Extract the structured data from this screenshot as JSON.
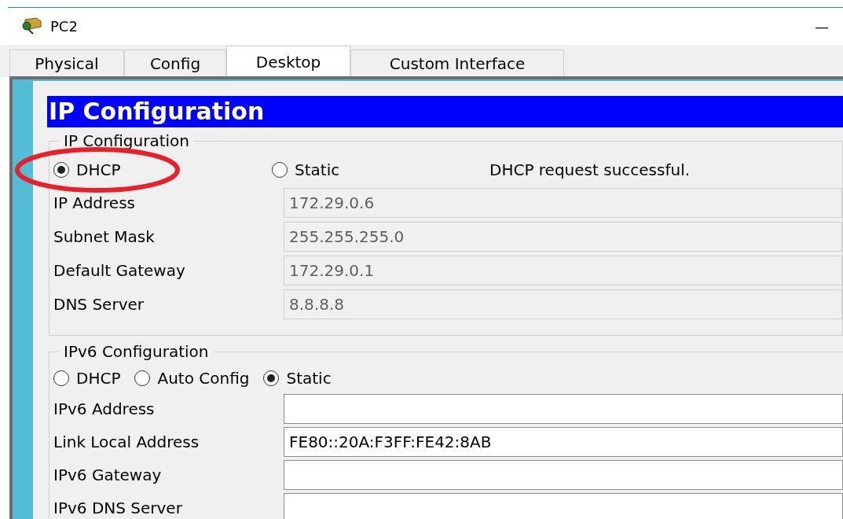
{
  "window": {
    "title": "PC2",
    "minimize": "—"
  },
  "tabs": [
    {
      "label": "Physical",
      "selected": false
    },
    {
      "label": "Config",
      "selected": false
    },
    {
      "label": "Desktop",
      "selected": true
    },
    {
      "label": "Custom Interface",
      "selected": false
    }
  ],
  "panel": {
    "header": "IP Configuration",
    "ipv4": {
      "legend": "IP Configuration",
      "modes": [
        {
          "label": "DHCP",
          "selected": true
        },
        {
          "label": "Static",
          "selected": false
        }
      ],
      "status": "DHCP request successful.",
      "fields": [
        {
          "label": "IP Address",
          "value": "172.29.0.6",
          "disabled": true
        },
        {
          "label": "Subnet Mask",
          "value": "255.255.255.0",
          "disabled": true
        },
        {
          "label": "Default Gateway",
          "value": "172.29.0.1",
          "disabled": true
        },
        {
          "label": "DNS Server",
          "value": "8.8.8.8",
          "disabled": true
        }
      ]
    },
    "ipv6": {
      "legend": "IPv6 Configuration",
      "modes": [
        {
          "label": "DHCP",
          "selected": false
        },
        {
          "label": "Auto Config",
          "selected": false
        },
        {
          "label": "Static",
          "selected": true
        }
      ],
      "fields": [
        {
          "label": "IPv6 Address",
          "disabled": false
        },
        {
          "label": "Link Local Address",
          "value": "FE80::20A:F3FF:FE42:8AB",
          "disabled": false
        },
        {
          "label": "IPv6 Gateway",
          "disabled": false
        },
        {
          "label": "IPv6 DNS Server",
          "disabled": false
        }
      ]
    }
  },
  "annotations": [
    {
      "kind": "ellipse"
    }
  ]
}
